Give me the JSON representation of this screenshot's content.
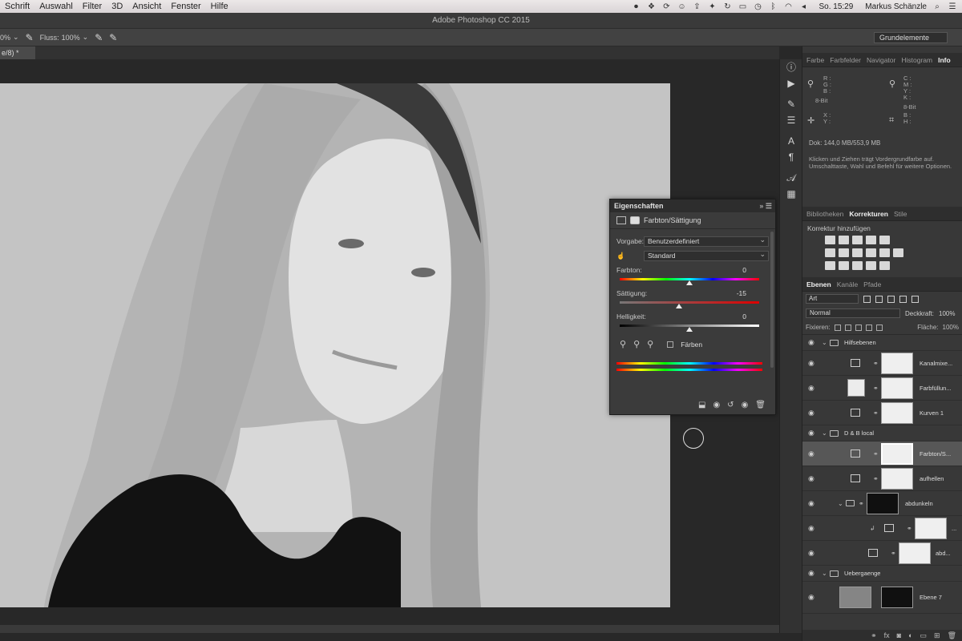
{
  "menubar": {
    "items": [
      "Schrift",
      "Auswahl",
      "Filter",
      "3D",
      "Ansicht",
      "Fenster",
      "Hilfe"
    ],
    "tray_icons": [
      "record-icon",
      "dropbox-icon",
      "sync-icon",
      "face-icon",
      "upload-icon",
      "bird-icon",
      "refresh-icon",
      "display-icon",
      "history-icon",
      "bluetooth-icon",
      "wifi-icon",
      "volume-icon"
    ],
    "clock": "So. 15:29",
    "user": "Markus Schänzle"
  },
  "titlebar": {
    "title": "Adobe Photoshop CC 2015"
  },
  "optionsbar": {
    "opacity_value": "0%",
    "flow_label": "Fluss:",
    "flow_value": "100%",
    "workspace": "Grundelemente"
  },
  "document": {
    "tab_label": "e/8) *"
  },
  "properties": {
    "title": "Eigenschaften",
    "adjustment": "Farbton/Sättigung",
    "preset_label": "Vorgabe:",
    "preset_value": "Benutzerdefiniert",
    "channel_value": "Standard",
    "hue_label": "Farbton:",
    "hue_value": "0",
    "hue": 0,
    "saturation_label": "Sättigung:",
    "saturation_value": "-15",
    "saturation": -15,
    "lightness_label": "Helligkeit:",
    "lightness_value": "0",
    "lightness": 0,
    "colorize_label": "Färben"
  },
  "info_panel": {
    "tabs": [
      "Farbe",
      "Farbfelder",
      "Navigator",
      "Histogram",
      "Info"
    ],
    "active_tab": "Info",
    "rgb_lines": "R :\nG :\nB :",
    "cmyk_lines": "C :\nM :\nY :\nK :",
    "bit_left": "8-Bit",
    "bit_right": "8-Bit",
    "xy_lines": "X :\nY :",
    "bh_lines": "B :\nH :",
    "doc_info": "Dok: 144,0 MB/553,9 MB",
    "hint": "Klicken und Ziehen trägt Vordergrundfarbe auf. Umschalttaste, Wahl und Befehl für weitere Optionen."
  },
  "corrections_panel": {
    "tabs": [
      "Bibliotheken",
      "Korrekturen",
      "Stile"
    ],
    "active_tab": "Korrekturen",
    "title": "Korrektur hinzufügen"
  },
  "layers_panel": {
    "tabs": [
      "Ebenen",
      "Kanäle",
      "Pfade"
    ],
    "active_tab": "Ebenen",
    "filter_value": "Art",
    "blend_mode": "Normal",
    "opacity_label": "Deckkraft:",
    "opacity_value": "100%",
    "lock_label": "Fixieren:",
    "fill_label": "Fläche:",
    "fill_value": "100%",
    "layers": [
      {
        "name": "Hilfsebenen"
      },
      {
        "name": "Kanalmixe..."
      },
      {
        "name": "Farbfüllun..."
      },
      {
        "name": "Kurven 1"
      },
      {
        "name": "D & B local"
      },
      {
        "name": "Farbton/S..."
      },
      {
        "name": "aufhellen"
      },
      {
        "name": "abdunkeln"
      },
      {
        "name": "..."
      },
      {
        "name": "abd..."
      },
      {
        "name": "Uebergaenge"
      },
      {
        "name": "Ebene 7"
      }
    ]
  }
}
